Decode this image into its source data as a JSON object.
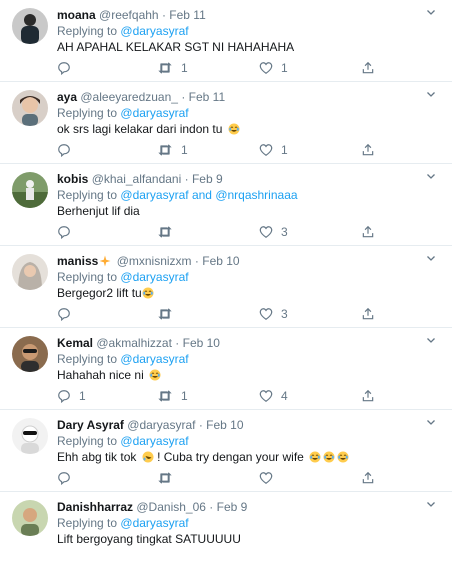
{
  "tweets": [
    {
      "name": "moana",
      "handle": "@reefqahh",
      "date": "Feb 11",
      "replying_label": "Replying to",
      "mentions": [
        "@daryasyraf"
      ],
      "mention_join": "",
      "text": "AH APAHAL KELAKAR SGT NI HAHAHAHA",
      "emojis": [],
      "retweets": "1",
      "likes": "1",
      "replies": ""
    },
    {
      "name": "aya",
      "handle": "@aleeyaredzuan_",
      "date": "Feb 11",
      "replying_label": "Replying to",
      "mentions": [
        "@daryasyraf"
      ],
      "mention_join": "",
      "text": "ok srs lagi kelakar dari indon tu",
      "emojis": [
        "joy"
      ],
      "retweets": "1",
      "likes": "1",
      "replies": ""
    },
    {
      "name": "kobis",
      "handle": "@khai_alfandani",
      "date": "Feb 9",
      "replying_label": "Replying to",
      "mentions": [
        "@daryasyraf",
        "@nrqashrinaaa"
      ],
      "mention_join": "and",
      "text": "Berhenjut lif dia",
      "emojis": [],
      "retweets": "",
      "likes": "3",
      "replies": ""
    },
    {
      "name": "maniss",
      "name_emoji": "sparkles",
      "handle": "@mxnisnizxm",
      "date": "Feb 10",
      "replying_label": "Replying to",
      "mentions": [
        "@daryasyraf"
      ],
      "mention_join": "",
      "text": "Bergegor2 lift tu",
      "emojis": [
        "joy"
      ],
      "retweets": "",
      "likes": "3",
      "replies": ""
    },
    {
      "name": "Kemal",
      "handle": "@akmalhizzat",
      "date": "Feb 10",
      "replying_label": "Replying to",
      "mentions": [
        "@daryasyraf"
      ],
      "mention_join": "",
      "text": "Hahahah nice ni",
      "emojis": [
        "joy"
      ],
      "retweets": "1",
      "likes": "4",
      "replies": "1"
    },
    {
      "name": "Dary Asyraf",
      "handle": "@daryasyraf",
      "date": "Feb 10",
      "replying_label": "Replying to",
      "mentions": [
        "@daryasyraf"
      ],
      "mention_join": "",
      "text": "Ehh abg tik tok",
      "text_after": "! Cuba try dengan your wife",
      "mid_emoji": "rofl",
      "emojis": [
        "joy",
        "joy",
        "joy"
      ],
      "retweets": "",
      "likes": "",
      "replies": ""
    },
    {
      "name": "Danishharraz",
      "handle": "@Danish_06",
      "date": "Feb 9",
      "replying_label": "Replying to",
      "mentions": [
        "@daryasyraf"
      ],
      "mention_join": "",
      "text": "Lift bergoyang tingkat SATUUUUU",
      "emojis": [],
      "retweets": "",
      "likes": "",
      "replies": ""
    }
  ],
  "dot_separator": "·",
  "icons": {
    "reply": "reply-icon",
    "retweet": "retweet-icon",
    "like": "like-icon",
    "share": "share-icon",
    "caret": "chevron-down-icon"
  },
  "colors": {
    "link": "#1da1f2",
    "muted": "#657786",
    "text": "#14171a",
    "border": "#e6ecf0"
  }
}
